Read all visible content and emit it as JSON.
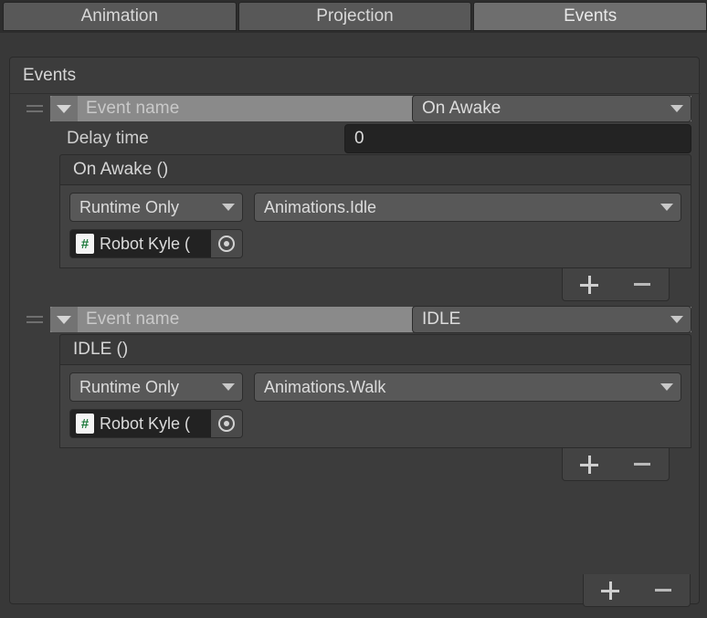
{
  "tabs": [
    {
      "label": "Animation",
      "active": false
    },
    {
      "label": "Projection",
      "active": false
    },
    {
      "label": "Events",
      "active": true
    }
  ],
  "panel": {
    "header_title": "Events"
  },
  "icons": {
    "drag_handle": "drag-handle-icon",
    "foldout_open": "triangle-down-icon",
    "dropdown_caret": "chevron-down-icon",
    "script_asset": "csharp-script-icon",
    "script_glyph": "#",
    "object_picker": "target-picker-icon",
    "plus": "plus-icon",
    "minus": "minus-icon"
  },
  "colors": {
    "window_bg": "#383838",
    "panel_bg": "#3c3c3c",
    "tab_inactive": "#585858",
    "tab_active": "#6e6e6e",
    "name_strip": "#8a8a8a",
    "dropdown_bg": "#585858",
    "input_dark": "#232323",
    "object_field_bg": "#222222",
    "text_primary": "#dcdcdc",
    "script_icon_green": "#1f7a3d"
  },
  "events": [
    {
      "foldout_label": "Event name",
      "event_type": "On Awake",
      "has_delay": true,
      "delay_label": "Delay time",
      "delay_value": "0",
      "signature": "On Awake ()",
      "calls": [
        {
          "mode": "Runtime Only",
          "function": "Animations.Idle",
          "object_name": "Robot Kyle ("
        }
      ],
      "footer": {
        "add_label": "+",
        "remove_label": "–"
      }
    },
    {
      "foldout_label": "Event name",
      "event_type": "IDLE",
      "has_delay": false,
      "delay_label": "",
      "delay_value": "",
      "signature": "IDLE ()",
      "calls": [
        {
          "mode": "Runtime Only",
          "function": "Animations.Walk",
          "object_name": "Robot Kyle ("
        }
      ],
      "footer": {
        "add_label": "+",
        "remove_label": "–"
      }
    }
  ],
  "list_footer": {
    "add_label": "+",
    "remove_label": "–"
  }
}
